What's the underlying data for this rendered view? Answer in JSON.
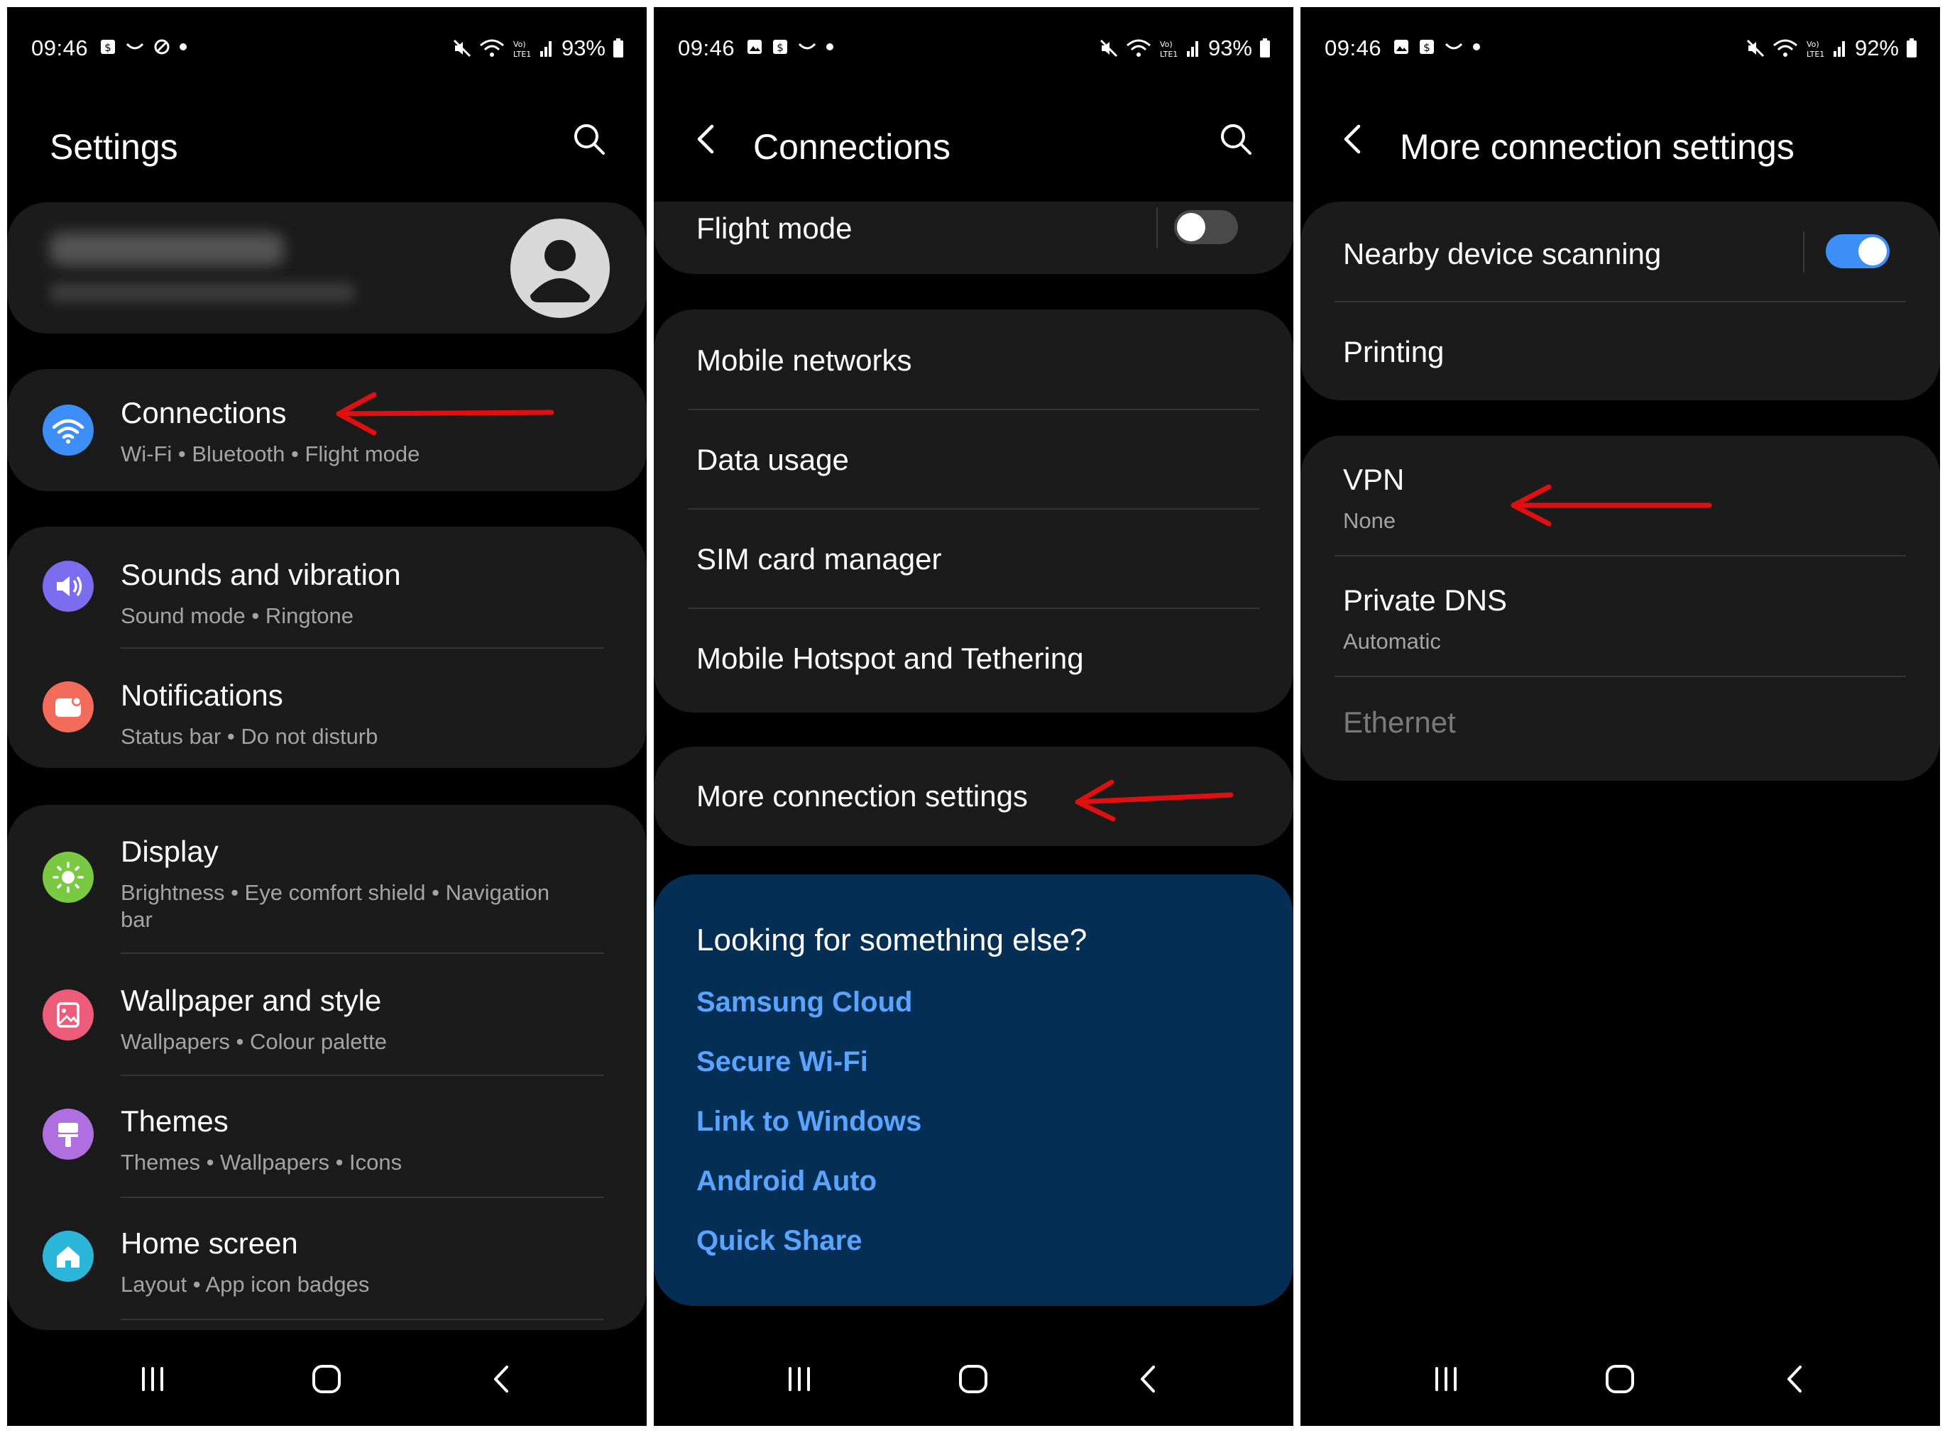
{
  "screens": {
    "settings": {
      "status": {
        "time": "09:46",
        "battery": "93%"
      },
      "title": "Settings",
      "items": [
        {
          "title": "Connections",
          "subtitle": "Wi-Fi  •  Bluetooth  •  Flight mode",
          "icon": "wifi-icon",
          "color": "#3e8ef7"
        },
        {
          "title": "Sounds and vibration",
          "subtitle": "Sound mode  •  Ringtone",
          "icon": "speaker-icon",
          "color": "#7b6cf0"
        },
        {
          "title": "Notifications",
          "subtitle": "Status bar  •  Do not disturb",
          "icon": "notification-icon",
          "color": "#f26b5b"
        },
        {
          "title": "Display",
          "subtitle": "Brightness  •  Eye comfort shield  •  Navigation",
          "subtitle2": "bar",
          "icon": "sun-icon",
          "color": "#7ac943"
        },
        {
          "title": "Wallpaper and style",
          "subtitle": "Wallpapers  •  Colour palette",
          "icon": "wallpaper-icon",
          "color": "#ee5c7c"
        },
        {
          "title": "Themes",
          "subtitle": "Themes  •  Wallpapers  •  Icons",
          "icon": "paint-brush-icon",
          "color": "#b06fe0"
        },
        {
          "title": "Home screen",
          "subtitle": "Layout  •  App icon badges",
          "icon": "home-icon",
          "color": "#2bb5d8"
        }
      ]
    },
    "connections": {
      "status": {
        "time": "09:46",
        "battery": "93%"
      },
      "title": "Connections",
      "flight_mode": "Flight mode",
      "items": [
        "Mobile networks",
        "Data usage",
        "SIM card manager",
        "Mobile Hotspot and Tethering"
      ],
      "more": "More connection settings",
      "looking": {
        "title": "Looking for something else?",
        "links": [
          "Samsung Cloud",
          "Secure Wi-Fi",
          "Link to Windows",
          "Android Auto",
          "Quick Share"
        ]
      }
    },
    "more_connection": {
      "status": {
        "time": "09:46",
        "battery": "92%"
      },
      "title": "More connection settings",
      "nearby": "Nearby device scanning",
      "printing": "Printing",
      "vpn": {
        "title": "VPN",
        "subtitle": "None"
      },
      "dns": {
        "title": "Private DNS",
        "subtitle": "Automatic"
      },
      "ethernet": "Ethernet"
    }
  },
  "colors": {
    "accent_blue": "#3e8ef7",
    "link_blue": "#5aa4ff",
    "annotation_arrow": "#e01010",
    "toggle_on": "#3e8ef7"
  }
}
